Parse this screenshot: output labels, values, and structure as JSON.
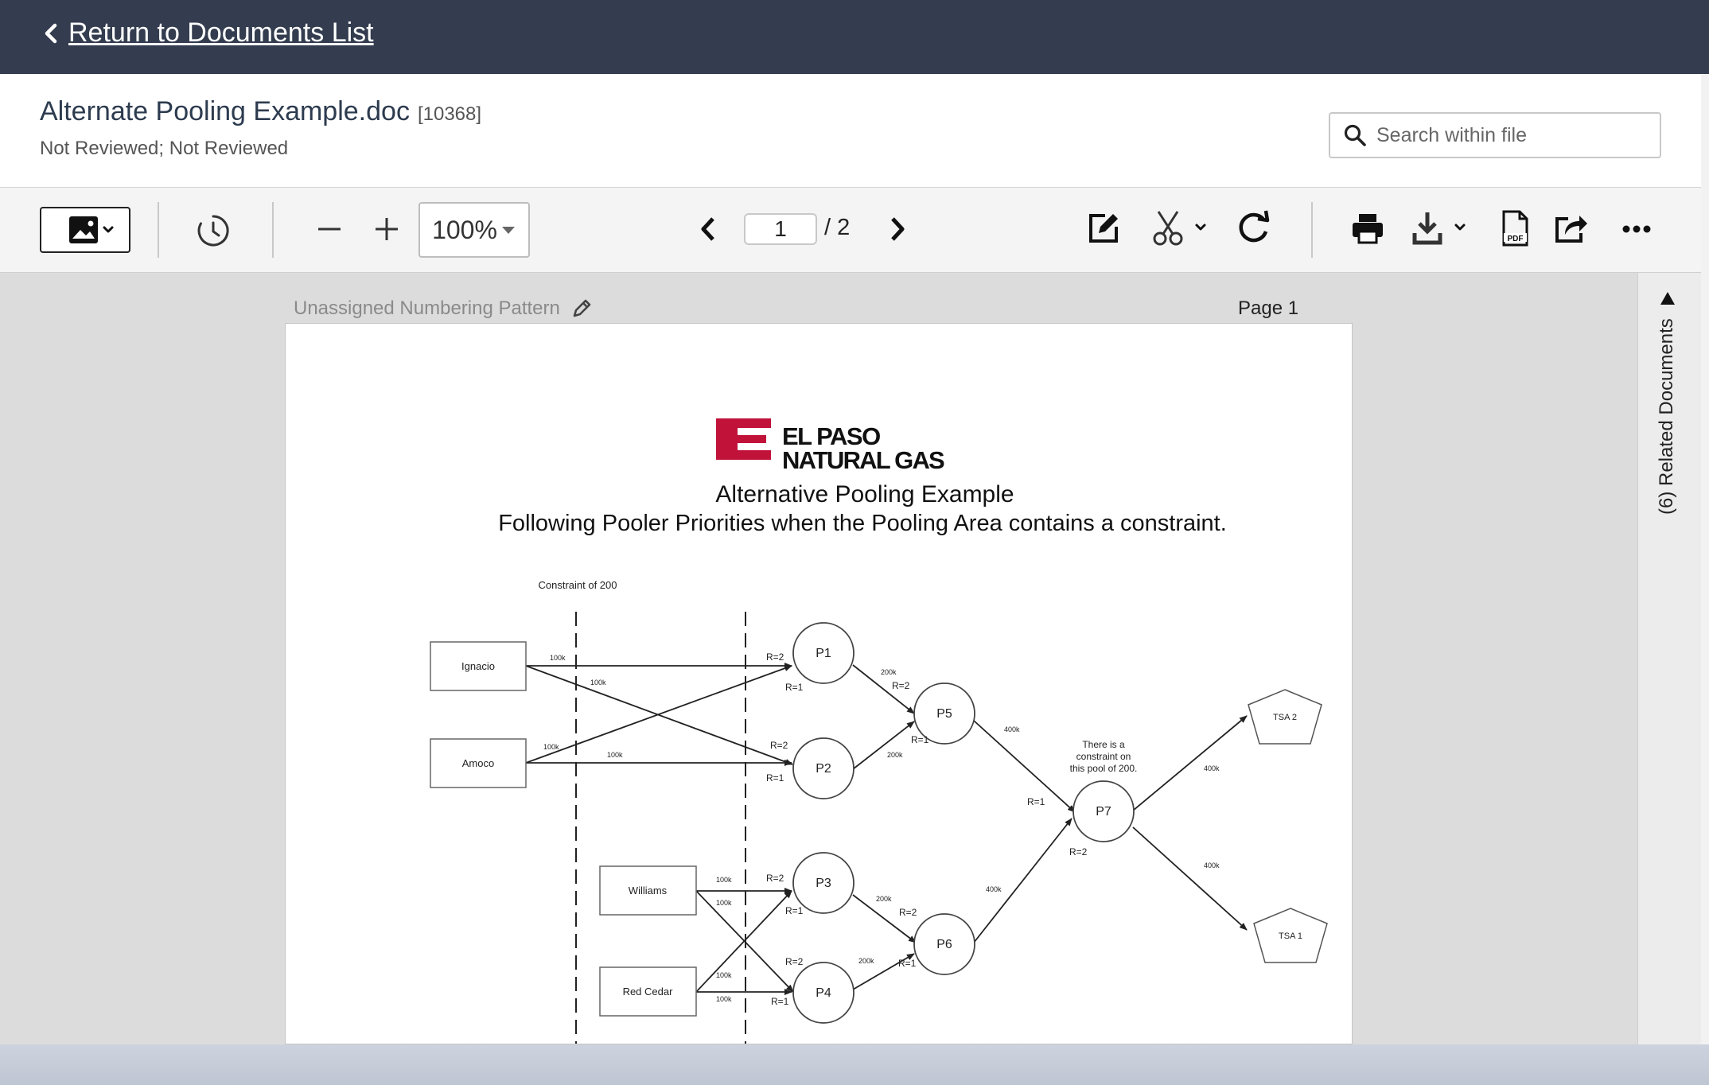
{
  "topbar": {
    "back_label": "Return to Documents List"
  },
  "document": {
    "title": "Alternate Pooling Example.doc",
    "id": "[10368]",
    "status": "Not Reviewed; Not Reviewed"
  },
  "search": {
    "placeholder": "Search within file"
  },
  "toolbar": {
    "zoom": "100%",
    "current_page": "1",
    "page_total": "/ 2"
  },
  "viewer": {
    "numbering_pattern": "Unassigned Numbering Pattern",
    "page_label": "Page 1"
  },
  "side_panel": {
    "related_label": "(6) Related Documents"
  },
  "page_content": {
    "logo_line1": "EL PASO",
    "logo_line2": "NATURAL GAS",
    "title": "Alternative Pooling Example",
    "subtitle": "Following Pooler Priorities when the Pooling Area contains a constraint.",
    "constraint_label": "Constraint of 200",
    "suppliers": [
      "Ignacio",
      "Amoco",
      "Williams",
      "Red Cedar"
    ],
    "pools": [
      "P1",
      "P2",
      "P3",
      "P4",
      "P5",
      "P6",
      "P7"
    ],
    "tsas": [
      "TSA 2",
      "TSA 1"
    ],
    "note": [
      "There is a",
      "constraint on",
      "this pool of 200."
    ],
    "labels": {
      "k100": "100k",
      "k200": "200k",
      "k400": "400k",
      "r1": "R=1",
      "r2": "R=2"
    }
  },
  "colors": {
    "topbar": "#343d4f",
    "logo_red": "#c1123a"
  }
}
